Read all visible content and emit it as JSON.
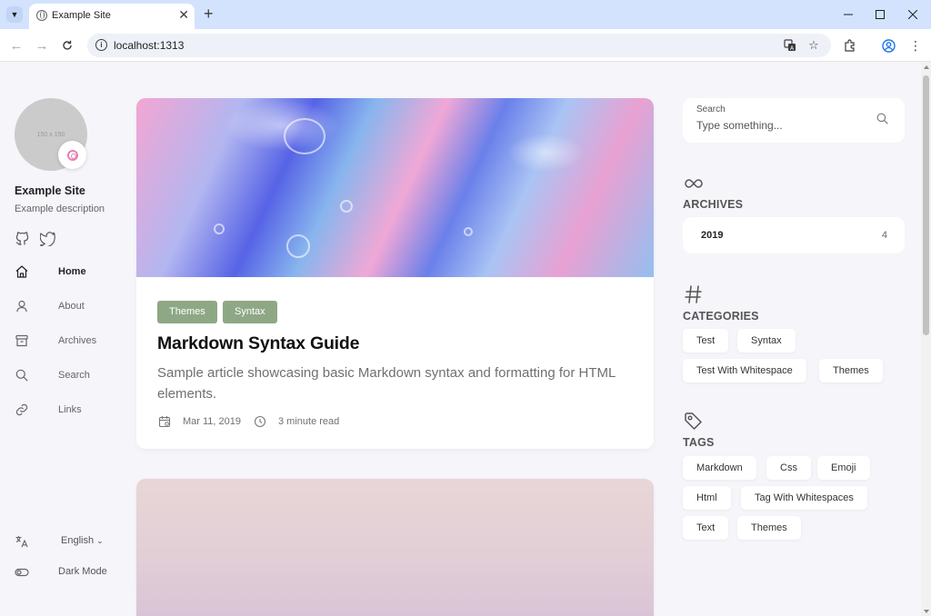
{
  "browser": {
    "tab_title": "Example Site",
    "url": "localhost:1313"
  },
  "sidebar": {
    "avatar_placeholder": "150 x 150",
    "site_name": "Example Site",
    "site_description": "Example description",
    "menu": [
      {
        "label": "Home",
        "icon": "home-icon",
        "active": true
      },
      {
        "label": "About",
        "icon": "user-icon",
        "active": false
      },
      {
        "label": "Archives",
        "icon": "archive-icon",
        "active": false
      },
      {
        "label": "Search",
        "icon": "search-icon",
        "active": false
      },
      {
        "label": "Links",
        "icon": "link-icon",
        "active": false
      }
    ],
    "language": "English",
    "dark_mode": "Dark Mode"
  },
  "article": {
    "categories": [
      "Themes",
      "Syntax"
    ],
    "title": "Markdown Syntax Guide",
    "subtitle": "Sample article showcasing basic Markdown syntax and formatting for HTML elements.",
    "date": "Mar 11, 2019",
    "read_time": "3 minute read"
  },
  "widgets": {
    "search": {
      "label": "Search",
      "placeholder": "Type something..."
    },
    "archives": {
      "title": "ARCHIVES",
      "year": "2019",
      "count": "4"
    },
    "categories": {
      "title": "CATEGORIES",
      "items": [
        "Test",
        "Syntax",
        "Test With Whitespace",
        "Themes"
      ]
    },
    "tags": {
      "title": "TAGS",
      "items": [
        "Markdown",
        "Css",
        "Emoji",
        "Html",
        "Tag With Whitespaces",
        "Text",
        "Themes"
      ]
    }
  },
  "colors": {
    "category_chip": "#8ea885",
    "page_background": "#f5f5fa",
    "browser_tabstrip": "#d3e3fd"
  }
}
